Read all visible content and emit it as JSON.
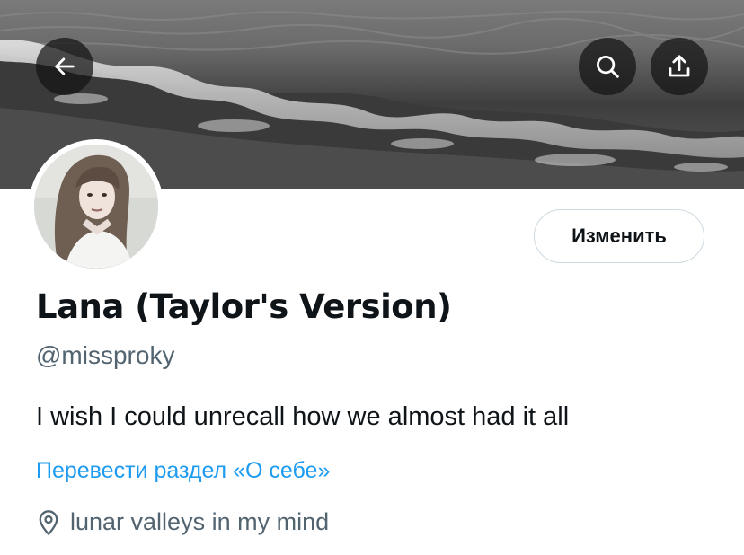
{
  "header": {
    "back_icon": "arrow-left-icon",
    "search_icon": "search-icon",
    "share_icon": "share-icon"
  },
  "profile": {
    "edit_button_label": "Изменить",
    "display_name": "Lana (Taylor's Version)",
    "handle": "@missproky",
    "bio": "I wish I could unrecall how we almost had it all",
    "translate_bio_link": "Перевести раздел «О себе»",
    "location": "lunar valleys in my mind",
    "location_icon": "location-pin-icon"
  },
  "colors": {
    "text_primary": "#0f1419",
    "text_secondary": "#536471",
    "link": "#1d9bf0",
    "button_border": "#cfd9de"
  }
}
